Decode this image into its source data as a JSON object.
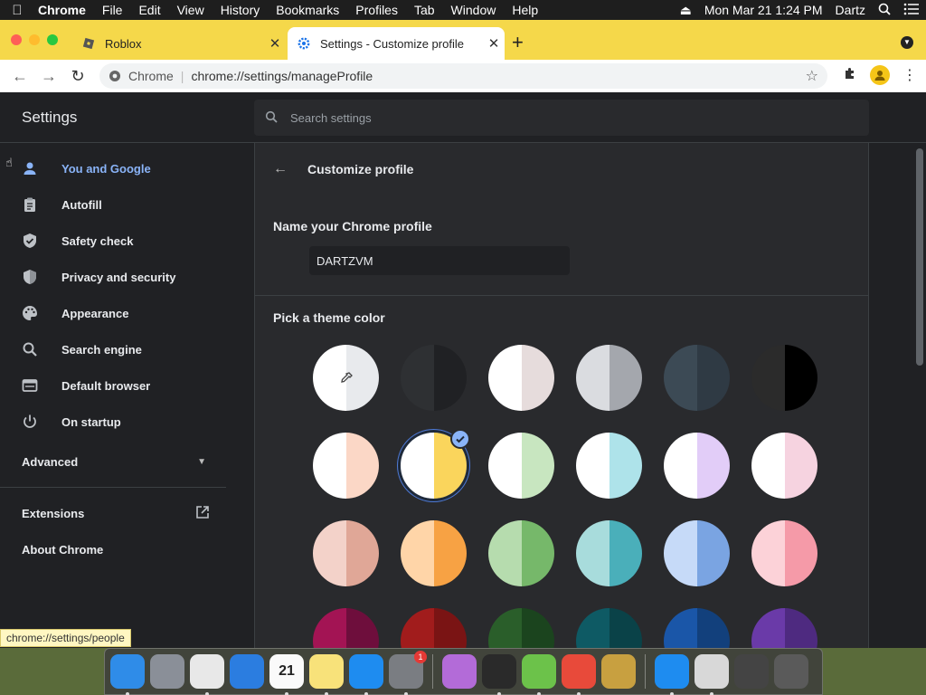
{
  "menubar": {
    "app": "Chrome",
    "items": [
      "File",
      "Edit",
      "View",
      "History",
      "Bookmarks",
      "Profiles",
      "Tab",
      "Window",
      "Help"
    ],
    "datetime": "Mon Mar 21  1:24 PM",
    "user": "Dartz"
  },
  "tabs": [
    {
      "title": "Roblox"
    },
    {
      "title": "Settings - Customize profile"
    }
  ],
  "omnibox": {
    "site": "Chrome",
    "url": "chrome://settings/manageProfile"
  },
  "settings": {
    "title": "Settings",
    "search_placeholder": "Search settings",
    "nav": [
      {
        "label": "You and Google",
        "icon": "person-icon",
        "active": true
      },
      {
        "label": "Autofill",
        "icon": "clipboard-icon"
      },
      {
        "label": "Safety check",
        "icon": "shield-check-icon"
      },
      {
        "label": "Privacy and security",
        "icon": "shield-icon"
      },
      {
        "label": "Appearance",
        "icon": "palette-icon"
      },
      {
        "label": "Search engine",
        "icon": "search-icon"
      },
      {
        "label": "Default browser",
        "icon": "browser-icon"
      },
      {
        "label": "On startup",
        "icon": "power-icon"
      }
    ],
    "advanced": "Advanced",
    "extensions": "Extensions",
    "about": "About Chrome"
  },
  "profile": {
    "heading": "Customize profile",
    "name_label": "Name your Chrome profile",
    "name_value": "DARTZVM",
    "theme_label": "Pick a theme color",
    "themes": [
      [
        {
          "l": "#ffffff",
          "r": "#e8eaed",
          "picker": true
        },
        {
          "l": "#2e3033",
          "r": "#202124"
        },
        {
          "l": "#ffffff",
          "r": "#e6dcdc"
        },
        {
          "l": "#dadce0",
          "r": "#a4a7ad"
        },
        {
          "l": "#3c4a55",
          "r": "#2f3a44"
        },
        {
          "l": "#2b2b2b",
          "r": "#000000"
        }
      ],
      [
        {
          "l": "#ffffff",
          "r": "#fbd7c6"
        },
        {
          "l": "#ffffff",
          "r": "#fad55c",
          "selected": true
        },
        {
          "l": "#ffffff",
          "r": "#c8e6c0"
        },
        {
          "l": "#ffffff",
          "r": "#aee3ea"
        },
        {
          "l": "#ffffff",
          "r": "#e2cdf8"
        },
        {
          "l": "#ffffff",
          "r": "#f6d3e0"
        }
      ],
      [
        {
          "l": "#f3d2c9",
          "r": "#e0a797"
        },
        {
          "l": "#ffd5a8",
          "r": "#f7a244"
        },
        {
          "l": "#b6dcae",
          "r": "#76b86a"
        },
        {
          "l": "#a8dcdc",
          "r": "#4aafba"
        },
        {
          "l": "#c6daf8",
          "r": "#7aa4e2"
        },
        {
          "l": "#fcd2d8",
          "r": "#f59aa8"
        }
      ],
      [
        {
          "l": "#a31454",
          "r": "#6e0e3c"
        },
        {
          "l": "#a11c1c",
          "r": "#7a1414"
        },
        {
          "l": "#2a5e2a",
          "r": "#1b441e"
        },
        {
          "l": "#0e5a64",
          "r": "#0a4248"
        },
        {
          "l": "#1a56a8",
          "r": "#12407c"
        },
        {
          "l": "#6a3aa8",
          "r": "#4e2a80"
        }
      ]
    ]
  },
  "status_url": "chrome://settings/people",
  "dock": {
    "apps": [
      {
        "name": "finder-icon",
        "color": "#2f8ce8"
      },
      {
        "name": "launchpad-icon",
        "color": "#8a8f98"
      },
      {
        "name": "chrome-icon",
        "color": "#e8e8e8"
      },
      {
        "name": "safari-icon",
        "color": "#2b7de0"
      },
      {
        "name": "calendar-icon",
        "color": "#fafafa",
        "label": "21"
      },
      {
        "name": "notes-icon",
        "color": "#f8e27a"
      },
      {
        "name": "app-store-icon",
        "color": "#1e8cf0"
      },
      {
        "name": "system-preferences-icon",
        "color": "#7a7d82",
        "badge": "1"
      },
      {
        "name": "potion-app-icon",
        "color": "#b36bd8"
      },
      {
        "name": "blocked-app-icon",
        "color": "#2a2a2a"
      },
      {
        "name": "bluestacks-icon",
        "color": "#6cc24a"
      },
      {
        "name": "multicolor-app-icon",
        "color": "#e84a3a"
      },
      {
        "name": "keychain-icon",
        "color": "#c8a040"
      },
      {
        "name": "app-store-2-icon",
        "color": "#1e8cf0"
      },
      {
        "name": "preview-icon",
        "color": "#d8d8d8"
      },
      {
        "name": "window-icon",
        "color": "#444444"
      },
      {
        "name": "trash-icon",
        "color": "#5a5a5a"
      }
    ]
  }
}
